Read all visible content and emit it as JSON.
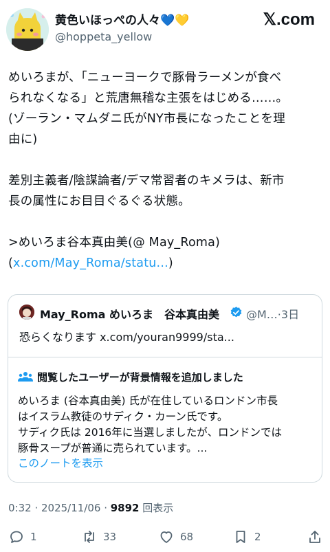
{
  "header": {
    "display_name": "黄色いほっぺの人々",
    "display_name_hearts": [
      "💙",
      "💛"
    ],
    "handle": "@hoppeta_yellow",
    "brand": "𝕏.com"
  },
  "post": {
    "lines": [
      "めいろまが、「ニューヨークで豚骨ラーメンが食べ",
      "られなくなる」と荒唐無稽な主張をはじめる……。",
      "(ゾーラン・マムダニ氏がNY市長になったことを理",
      "由に)",
      "",
      "差別主義者/陰謀論者/デマ常習者のキメラは、新市",
      "長の属性にお目目ぐるぐる状態。",
      "",
      ">めいろま谷本真由美(@ May_Roma)"
    ],
    "link_prefix": "(",
    "link_text": "x.com/May_Roma/statu...",
    "link_suffix": ")"
  },
  "quote": {
    "author": "May_Roma めいろま　谷本真由美",
    "meta": "@M…·3日",
    "text": "恐らくなります x.com/youran9999/sta...",
    "note_heading": "閲覧したユーザーが背景情報を追加しました",
    "note_lines": [
      "めいろま (谷本真由美) 氏が在住しているロンドン市長",
      "はイスラム教徒のサディク・カーン氏です。",
      "サディク氏は 2016年に当選しましたが、ロンドンでは",
      "豚骨スープが普通に売られています。..."
    ],
    "note_link": "このノートを表示"
  },
  "timestamp": {
    "time": "0:32 · 2025/11/06 · ",
    "views": "9892",
    "views_label": " 回表示"
  },
  "actions": {
    "replies": "1",
    "reposts": "33",
    "likes": "68",
    "bookmarks": "2"
  },
  "colors": {
    "link": "#1d9bf0",
    "secondary_text": "#536471",
    "border": "#cfd9de",
    "verified": "#1d9bf0"
  }
}
